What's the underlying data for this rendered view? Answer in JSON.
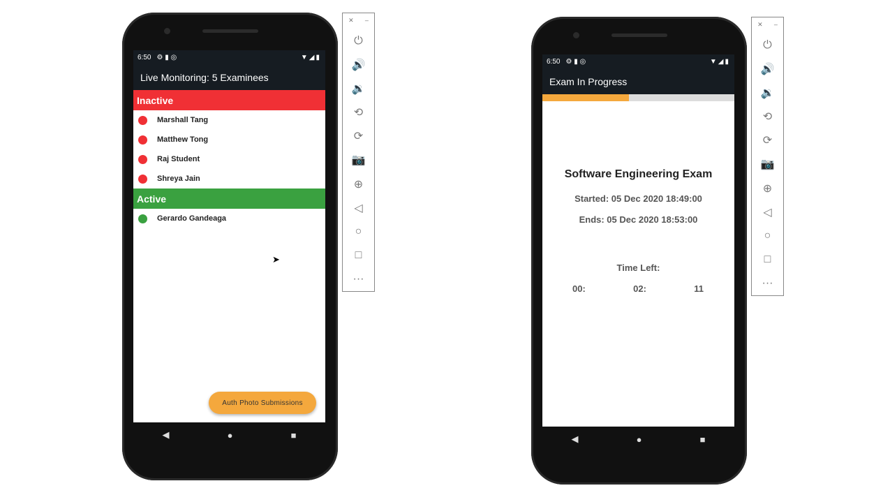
{
  "left_phone": {
    "status": {
      "time": "6:50",
      "icons_left": "⚙ ▮ ◎",
      "icons_right": "▼◢▮"
    },
    "title": "Live Monitoring: 5 Examinees",
    "inactive": {
      "label": "Inactive",
      "color": "#f03035",
      "examinees": [
        "Marshall Tang",
        "Matthew Tong",
        "Raj Student",
        "Shreya Jain"
      ]
    },
    "active": {
      "label": "Active",
      "color": "#3aa140",
      "examinees": [
        "Gerardo Gandeaga"
      ]
    },
    "fab_label": "Auth Photo Submissions"
  },
  "right_phone": {
    "status": {
      "time": "6:50",
      "icons_left": "⚙ ▮ ◎",
      "icons_right": "▼◢▮"
    },
    "title": "Exam In Progress",
    "progress": 0.45,
    "exam_name": "Software Engineering Exam",
    "started": "Started: 05 Dec 2020 18:49:00",
    "ends": "Ends: 05 Dec 2020 18:53:00",
    "time_left_label": "Time Left:",
    "hours": "00:",
    "minutes": "02:",
    "seconds": "11"
  },
  "nav": {
    "back": "◀",
    "home": "●",
    "recents": "■"
  },
  "panel": {
    "close": "✕",
    "minimize": "–",
    "buttons": [
      {
        "name": "power",
        "glyph": "⏻"
      },
      {
        "name": "volume-up",
        "glyph": "🔊"
      },
      {
        "name": "volume-down",
        "glyph": "🔉"
      },
      {
        "name": "rotate-left",
        "glyph": "⟲"
      },
      {
        "name": "rotate-right",
        "glyph": "⟳"
      },
      {
        "name": "camera",
        "glyph": "📷"
      },
      {
        "name": "zoom",
        "glyph": "⊕"
      },
      {
        "name": "back",
        "glyph": "◁"
      },
      {
        "name": "home",
        "glyph": "○"
      },
      {
        "name": "overview",
        "glyph": "□"
      },
      {
        "name": "more",
        "glyph": "···"
      }
    ]
  }
}
